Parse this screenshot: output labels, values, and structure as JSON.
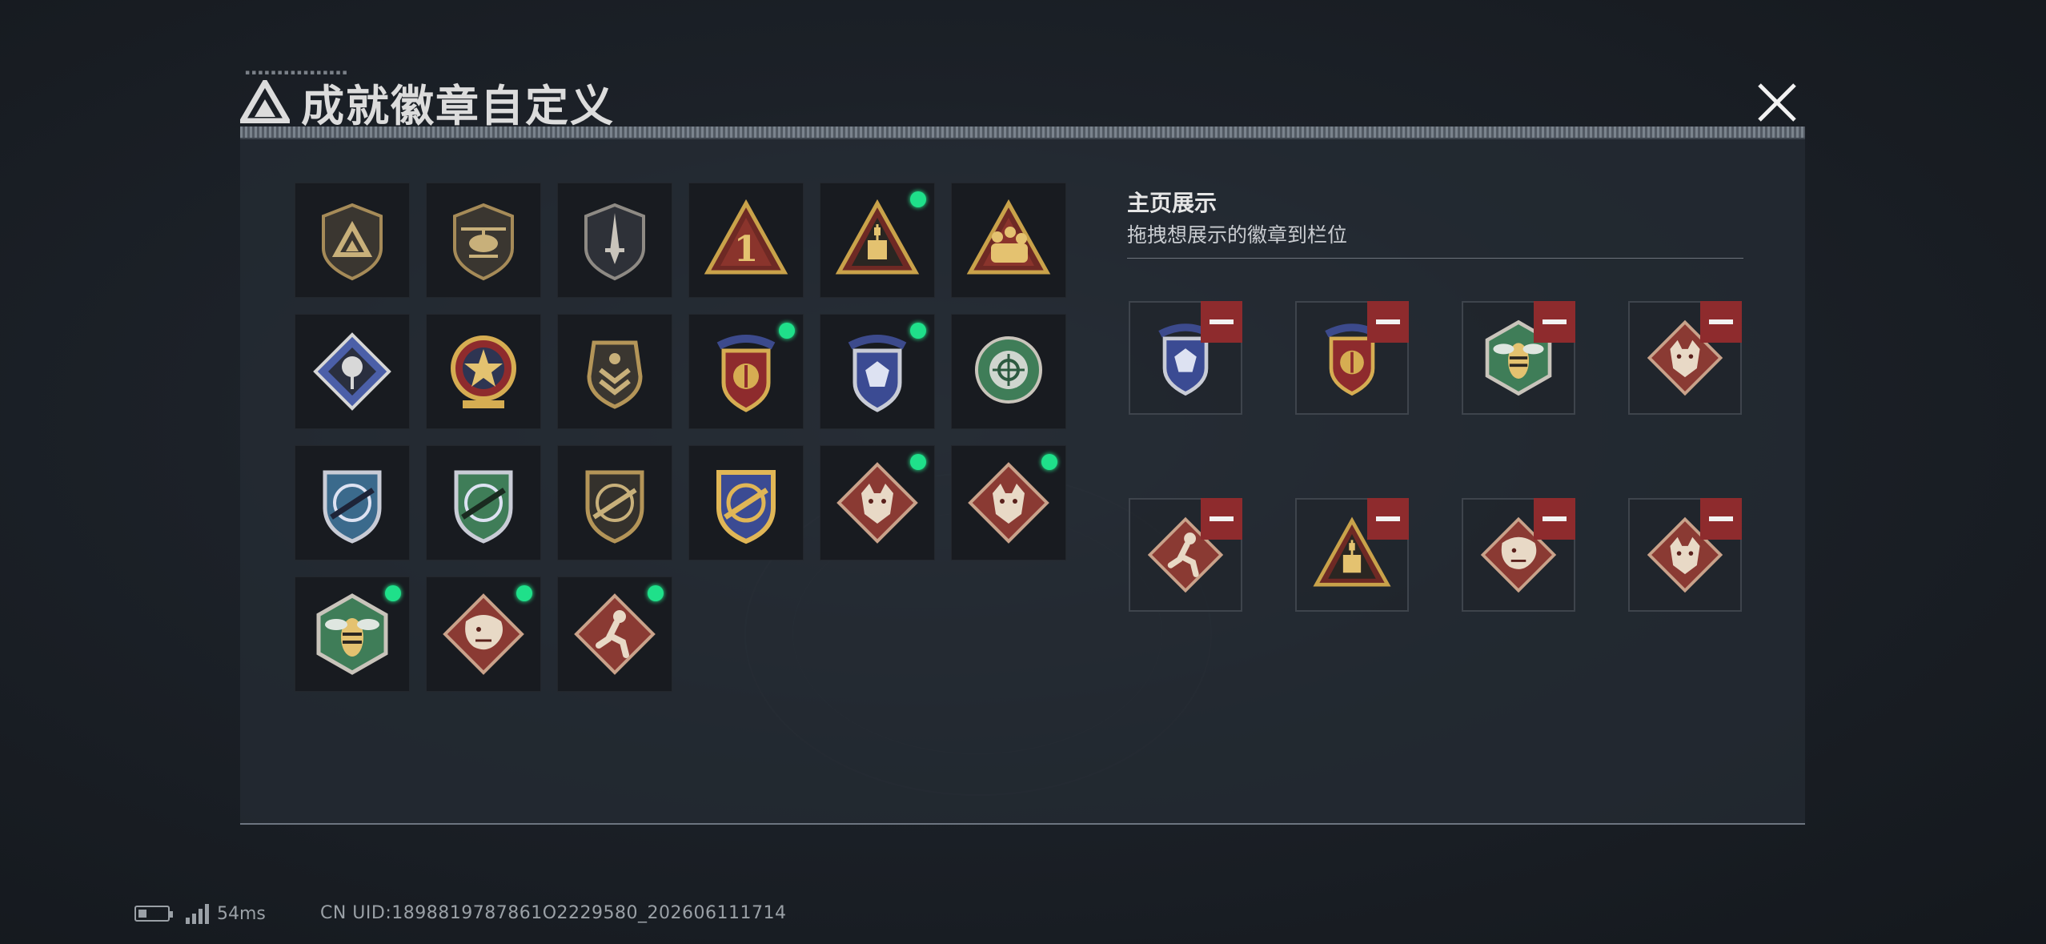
{
  "header": {
    "title": "成就徽章自定义",
    "logo_icon": "triangle-logo-icon",
    "close_icon": "close-icon"
  },
  "collection": {
    "badges": [
      {
        "icon": "triangle-shield-badge-icon",
        "new": false
      },
      {
        "icon": "helicopter-badge-icon",
        "new": false
      },
      {
        "icon": "dagger-shield-badge-icon",
        "new": false
      },
      {
        "icon": "number-one-triangle-badge-icon",
        "new": false
      },
      {
        "icon": "supply-drop-triangle-badge-icon",
        "new": true
      },
      {
        "icon": "soldiers-triangle-badge-icon",
        "new": false
      },
      {
        "icon": "rose-diamond-badge-icon",
        "new": false
      },
      {
        "icon": "star-medal-badge-icon",
        "new": false
      },
      {
        "icon": "chevron-shield-badge-icon",
        "new": false
      },
      {
        "icon": "gold-wing-crest-badge-icon",
        "new": true
      },
      {
        "icon": "blue-gem-crest-badge-icon",
        "new": true
      },
      {
        "icon": "green-crosshair-badge-icon",
        "new": false
      },
      {
        "icon": "blue-rifle-shield-badge-icon",
        "new": false
      },
      {
        "icon": "green-rifle-shield-badge-icon",
        "new": false
      },
      {
        "icon": "dark-rifle-shield-badge-icon",
        "new": false
      },
      {
        "icon": "gold-rifle-shield-badge-icon",
        "new": false
      },
      {
        "icon": "wolf-diamond-badge-icon",
        "new": true
      },
      {
        "icon": "wolf-diamond-badge-icon",
        "new": true
      },
      {
        "icon": "hornet-hexagon-badge-icon",
        "new": true
      },
      {
        "icon": "dragon-diamond-badge-icon",
        "new": true
      },
      {
        "icon": "runner-diamond-badge-icon",
        "new": true
      }
    ]
  },
  "showcase": {
    "title": "主页展示",
    "subtitle": "拖拽想展示的徽章到栏位",
    "slots": [
      {
        "icon": "blue-gem-crest-badge-icon"
      },
      {
        "icon": "gold-wing-crest-badge-icon"
      },
      {
        "icon": "hornet-hexagon-badge-icon"
      },
      {
        "icon": "wolf-diamond-badge-icon"
      },
      {
        "icon": "runner-diamond-badge-icon"
      },
      {
        "icon": "supply-drop-triangle-badge-icon"
      },
      {
        "icon": "dragon-diamond-badge-icon"
      },
      {
        "icon": "wolf-diamond-badge-icon"
      }
    ]
  },
  "status_bar": {
    "ping": "54ms",
    "uid": "CN UID:1898819787861O2229580_202606111714"
  },
  "colors": {
    "new_dot": "#1fe08a",
    "remove_button": "#8e2b2d",
    "gold": "#c9a24a",
    "blue": "#4b5fa8",
    "green": "#3f7d58",
    "red_diamond": "#8a3a33"
  }
}
